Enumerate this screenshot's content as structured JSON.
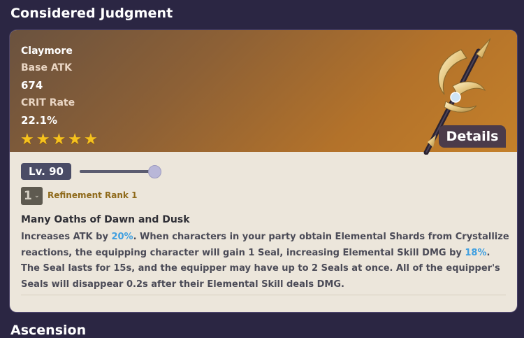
{
  "page": {
    "title": "Considered Judgment",
    "next_section": "Ascension"
  },
  "weapon": {
    "type": "Claymore",
    "stats": [
      {
        "label": "Base ATK",
        "value": "674"
      },
      {
        "label": "CRIT Rate",
        "value": "22.1%"
      }
    ],
    "rarity_stars": 5,
    "details_label": "Details",
    "weapon_icon": "claymore-weapon-icon"
  },
  "level": {
    "label": "Lv. 90",
    "fraction": 1.0
  },
  "refinement": {
    "selected": "1",
    "label": "Refinement Rank 1"
  },
  "passive": {
    "name": "Many Oaths of Dawn and Dusk",
    "desc_1": "Increases ATK by ",
    "hl_1": "20%",
    "desc_2": ". When characters in your party obtain Elemental Shards from Crystallize reactions, the equipping character will gain 1 Seal, increasing Elemental Skill DMG by ",
    "hl_2": "18%",
    "desc_3": ". The Seal lasts for 15s, and the equipper may have up to 2 Seals at once. All of the equipper's Seals will disappear 0.2s after their Elemental Skill deals DMG."
  },
  "colors": {
    "background": "#2b2643",
    "card": "#ece6db",
    "star": "#f6c21d",
    "highlight": "#3f9fe0",
    "refine_text": "#8f6a1b"
  }
}
